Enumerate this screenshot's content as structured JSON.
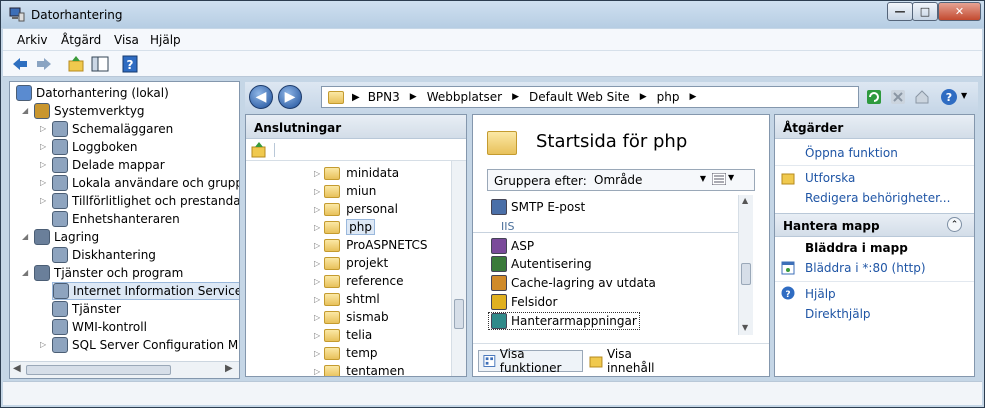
{
  "window": {
    "title": "Datorhantering"
  },
  "menu": [
    "Arkiv",
    "Åtgärd",
    "Visa",
    "Hjälp"
  ],
  "left_tree": [
    {
      "label": "Datorhantering (lokal)",
      "indent": 0,
      "tri": ""
    },
    {
      "label": "Systemverktyg",
      "indent": 1,
      "tri": "◢"
    },
    {
      "label": "Schemaläggaren",
      "indent": 2,
      "tri": "▷"
    },
    {
      "label": "Loggboken",
      "indent": 2,
      "tri": "▷"
    },
    {
      "label": "Delade mappar",
      "indent": 2,
      "tri": "▷"
    },
    {
      "label": "Lokala användare och grupper",
      "indent": 2,
      "tri": "▷"
    },
    {
      "label": "Tillförlitlighet och prestanda",
      "indent": 2,
      "tri": "▷"
    },
    {
      "label": "Enhetshanteraren",
      "indent": 2,
      "tri": ""
    },
    {
      "label": "Lagring",
      "indent": 1,
      "tri": "◢"
    },
    {
      "label": "Diskhantering",
      "indent": 2,
      "tri": ""
    },
    {
      "label": "Tjänster och program",
      "indent": 1,
      "tri": "◢"
    },
    {
      "label": "Internet Information Services (II",
      "indent": 2,
      "tri": "",
      "selected": true
    },
    {
      "label": "Tjänster",
      "indent": 2,
      "tri": ""
    },
    {
      "label": "WMI-kontroll",
      "indent": 2,
      "tri": ""
    },
    {
      "label": "SQL Server Configuration Mana",
      "indent": 2,
      "tri": "▷"
    }
  ],
  "address": {
    "crumbs": [
      "BPN3",
      "Webbplatser",
      "Default Web Site",
      "php"
    ]
  },
  "connections": {
    "title": "Anslutningar",
    "items": [
      "minidata",
      "miun",
      "personal",
      "php",
      "ProASPNETCS",
      "projekt",
      "reference",
      "shtml",
      "sismab",
      "telia",
      "temp",
      "tentamen"
    ]
  },
  "center": {
    "title": "Startsida för php",
    "group_label": "Gruppera efter:",
    "group_value": "Område",
    "group_header": "IIS",
    "features": [
      "SMTP E-post",
      "ASP",
      "Autentisering",
      "Cache-lagring av utdata",
      "Felsidor",
      "Hanterarmappningar"
    ],
    "tab_features": "Visa funktioner",
    "tab_content": "Visa innehåll"
  },
  "actions": {
    "title": "Åtgärder",
    "open": "Öppna funktion",
    "explore": "Utforska",
    "edit_perm": "Redigera behörigheter...",
    "section": "Hantera mapp",
    "browse_title": "Bläddra i mapp",
    "browse_link": "Bläddra i *:80 (http)",
    "help": "Hjälp",
    "online_help": "Direkthjälp"
  }
}
